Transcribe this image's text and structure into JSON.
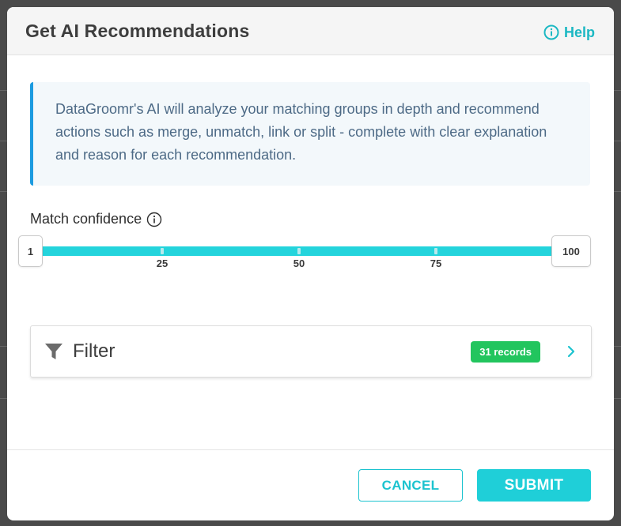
{
  "modal": {
    "title": "Get AI Recommendations",
    "help_label": "Help"
  },
  "info": {
    "text": "DataGroomr's AI will analyze your matching groups in depth and recommend actions such as merge, unmatch, link or split - complete with clear explanation and reason for each recommendation."
  },
  "confidence": {
    "label": "Match confidence",
    "min_value": "1",
    "max_value": "100",
    "ticks": [
      "25",
      "50",
      "75"
    ]
  },
  "filter": {
    "label": "Filter",
    "records_badge": "31 records"
  },
  "footer": {
    "cancel_label": "CANCEL",
    "submit_label": "SUBMIT"
  },
  "colors": {
    "accent": "#1fcfd8",
    "info_border": "#1c9be0",
    "badge_green": "#22c55e"
  },
  "icons": [
    "help-circle-icon",
    "info-icon",
    "filter-funnel-icon",
    "chevron-right-icon"
  ]
}
